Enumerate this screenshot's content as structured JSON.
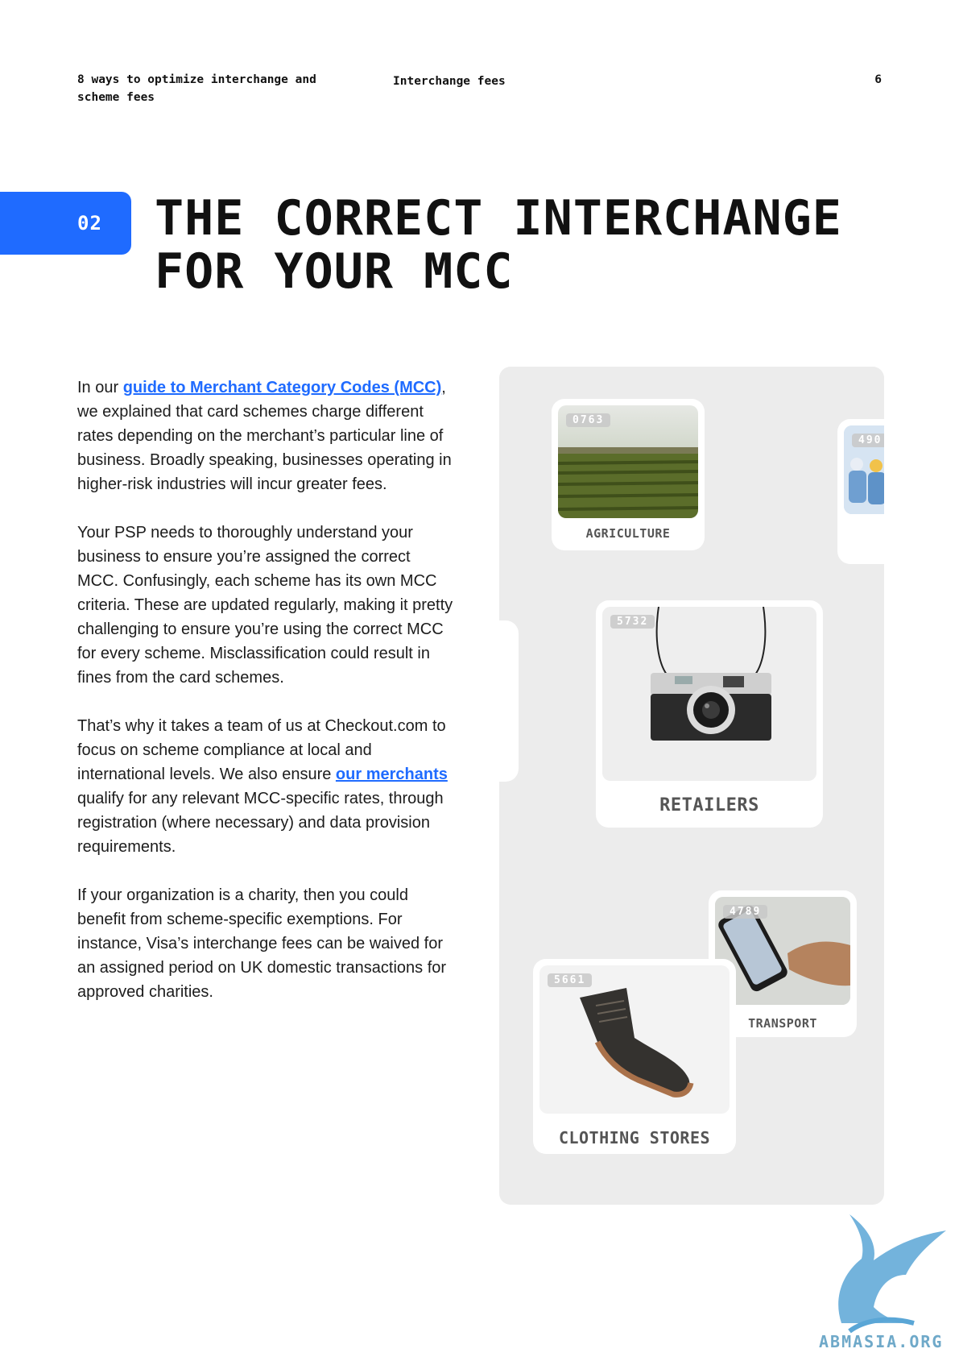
{
  "header": {
    "left": "8 ways to optimize interchange and scheme fees",
    "center": "Interchange fees",
    "page_number": "6"
  },
  "section": {
    "number": "02",
    "title": "THE CORRECT INTERCHANGE FOR YOUR MCC"
  },
  "body": {
    "p1_before": "In our ",
    "p1_link": "guide to Merchant Category Codes (MCC)",
    "p1_after": ", we explained that card schemes charge different rates depending on the merchant’s particular line of business. Broadly speaking, businesses operating in higher-risk industries will incur greater fees.",
    "p2": "Your PSP needs to thoroughly understand your business to ensure you’re assigned the correct MCC. Confusingly, each scheme has its own MCC criteria. These are updated regularly, making it pretty challenging to ensure you’re using the correct MCC for every scheme. Misclassification could result in fines from the card schemes.",
    "p3_before": "That’s why it takes a team of us at Checkout.com to focus on scheme compliance at local and international levels. We also ensure ",
    "p3_link": "our merchants",
    "p3_after": " qualify for any relevant MCC-specific rates, through registration (where necessary) and data provision requirements.",
    "p4": "If your organization is a charity, then you could benefit from scheme-specific exemptions. For instance, Visa’s interchange fees can be waived for an assigned period on UK domestic transactions for approved charities."
  },
  "cards": {
    "agriculture": {
      "code": "0763",
      "label": "AGRICULTURE"
    },
    "partial": {
      "code": "490"
    },
    "retailers": {
      "code": "5732",
      "label": "RETAILERS"
    },
    "transport": {
      "code": "4789",
      "label": "TRANSPORT"
    },
    "clothing": {
      "code": "5661",
      "label": "CLOTHING STORES"
    }
  },
  "logo": {
    "text": "ABMASIA.ORG"
  },
  "colors": {
    "accent": "#1f6bff",
    "panel": "#ececec"
  }
}
